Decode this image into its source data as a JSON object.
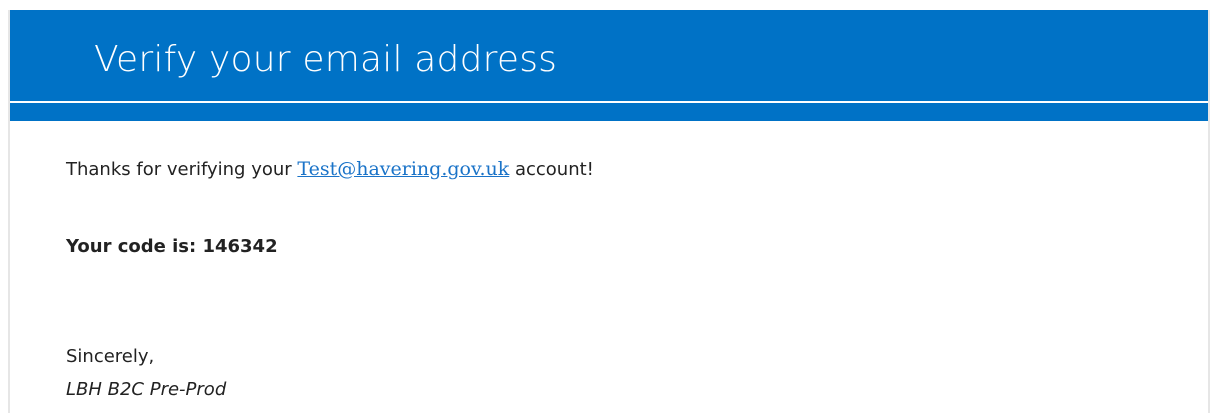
{
  "header": {
    "title": "Verify your email address",
    "band_color": "#0072c6"
  },
  "message": {
    "thanks_prefix": "Thanks for verifying your ",
    "email": "Test@havering.gov.uk",
    "thanks_suffix": " account!",
    "code_label": "Your code is: ",
    "code": "146342",
    "closing": "Sincerely,",
    "signature": "LBH B2C Pre-Prod"
  },
  "colors": {
    "link": "#1a73c8",
    "text": "#222222"
  }
}
